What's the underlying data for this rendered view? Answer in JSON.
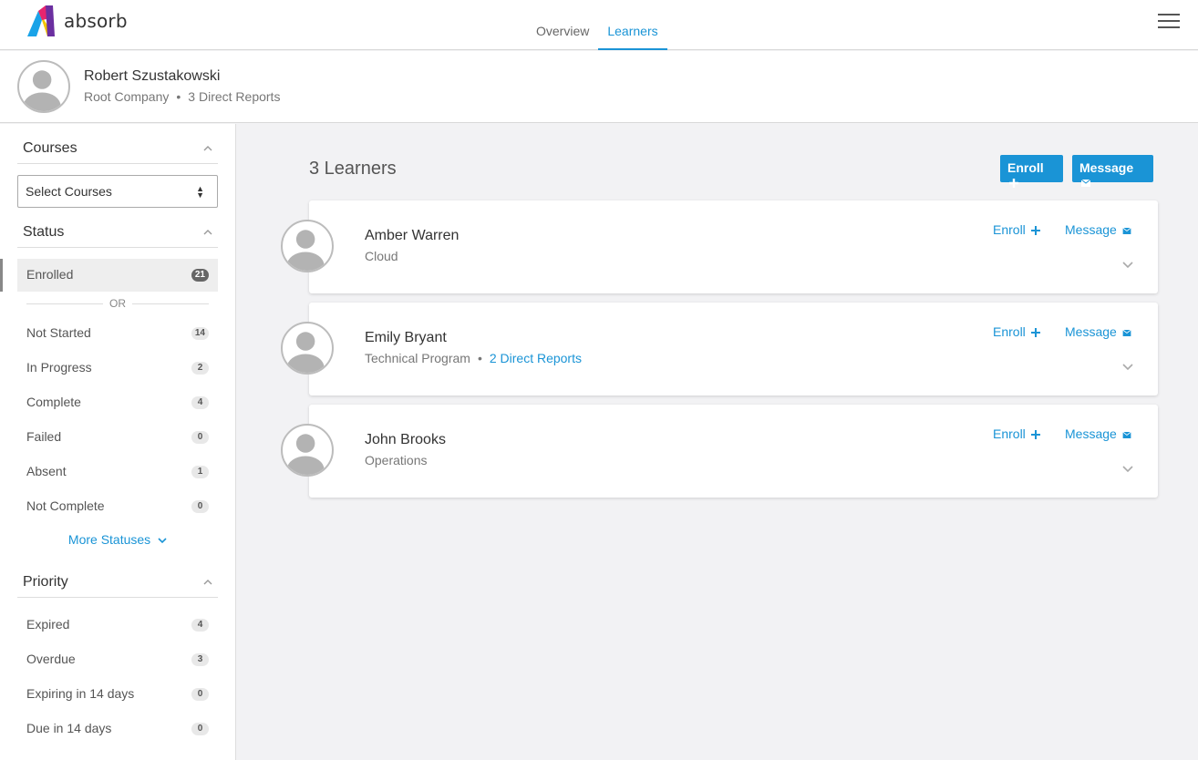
{
  "app": {
    "logo_text": "absorb"
  },
  "nav": {
    "tabs": [
      {
        "label": "Overview"
      },
      {
        "label": "Learners"
      }
    ],
    "active_tab": "Learners"
  },
  "profile": {
    "name": "Robert Szustakowski",
    "company": "Root Company",
    "reports": "3 Direct Reports"
  },
  "sidebar": {
    "courses": {
      "title": "Courses",
      "select_value": "Select Courses"
    },
    "status": {
      "title": "Status",
      "enrolled": {
        "label": "Enrolled",
        "count": "21"
      },
      "or_label": "OR",
      "items": [
        {
          "label": "Not Started",
          "count": "14"
        },
        {
          "label": "In Progress",
          "count": "2"
        },
        {
          "label": "Complete",
          "count": "4"
        },
        {
          "label": "Failed",
          "count": "0"
        },
        {
          "label": "Absent",
          "count": "1"
        },
        {
          "label": "Not Complete",
          "count": "0"
        }
      ],
      "more_label": "More Statuses"
    },
    "priority": {
      "title": "Priority",
      "items": [
        {
          "label": "Expired",
          "count": "4"
        },
        {
          "label": "Overdue",
          "count": "3"
        },
        {
          "label": "Expiring in 14 days",
          "count": "0"
        },
        {
          "label": "Due in 14 days",
          "count": "0"
        }
      ]
    }
  },
  "main": {
    "title": "3 Learners",
    "enroll_label": "Enroll",
    "message_label": "Message",
    "learners": [
      {
        "name": "Amber Warren",
        "department": "Cloud",
        "reports": "",
        "enroll_label": "Enroll",
        "message_label": "Message"
      },
      {
        "name": "Emily Bryant",
        "department": "Technical Program",
        "reports": "2 Direct Reports",
        "enroll_label": "Enroll",
        "message_label": "Message"
      },
      {
        "name": "John Brooks",
        "department": "Operations",
        "reports": "",
        "enroll_label": "Enroll",
        "message_label": "Message"
      }
    ]
  },
  "colors": {
    "accent": "#1a94d6",
    "background": "#f2f2f4"
  }
}
